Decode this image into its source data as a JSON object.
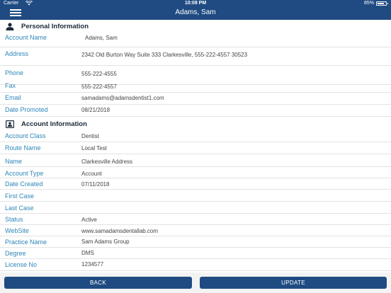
{
  "status_bar": {
    "carrier": "Carrier",
    "time": "10:08 PM",
    "battery_percent": "85%",
    "battery_level": 0.85
  },
  "nav": {
    "title": "Adams, Sam"
  },
  "personal": {
    "title": "Personal Information",
    "rows": [
      {
        "label": "Account Name",
        "value": "Adams, Sam"
      },
      {
        "label": "Address",
        "value": "2342 Old Burton Way Suite 333  Clarkesville, 555-222-4557 30523"
      },
      {
        "label": "Phone",
        "value": "555-222-4555"
      },
      {
        "label": "Fax",
        "value": "555-222-4557"
      },
      {
        "label": "Email",
        "value": "samadams@adamsdentist1.com"
      },
      {
        "label": "Date Promoted",
        "value": "08/21/2018"
      }
    ]
  },
  "account": {
    "title": "Account Information",
    "rows": [
      {
        "label": "Account Class",
        "value": "Dentist"
      },
      {
        "label": "Route Name",
        "value": "Local Test"
      },
      {
        "label": "Name",
        "value": "Clarkesville Address"
      },
      {
        "label": "Account Type",
        "value": "Account"
      },
      {
        "label": "Date Created",
        "value": "07/11/2018"
      },
      {
        "label": "First Case",
        "value": ""
      },
      {
        "label": "Last Case",
        "value": ""
      },
      {
        "label": "Status",
        "value": "Active"
      },
      {
        "label": "WebSite",
        "value": "www.samadamsdentallab.com"
      },
      {
        "label": "Practice Name",
        "value": "Sam Adams Group"
      },
      {
        "label": "Degree",
        "value": "DMS"
      },
      {
        "label": "License No",
        "value": "1234577"
      }
    ]
  },
  "buttons": {
    "back": "BACK",
    "update": "UPDATE"
  }
}
